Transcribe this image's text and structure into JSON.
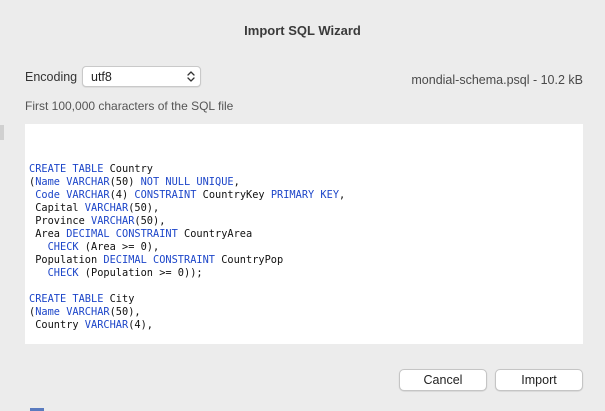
{
  "window": {
    "title": "Import SQL Wizard"
  },
  "encoding": {
    "label": "Encoding",
    "value": "utf8"
  },
  "file": {
    "info": "mondial-schema.psql - 10.2 kB"
  },
  "preview": {
    "label": "First 100,000 characters of the SQL file",
    "lines": [
      [],
      [],
      [],
      [
        [
          "kw",
          "CREATE TABLE "
        ],
        [
          "tx",
          "Country"
        ]
      ],
      [
        [
          "tx",
          "("
        ],
        [
          "kw",
          "Name VARCHAR"
        ],
        [
          "tx",
          "(50) "
        ],
        [
          "kw",
          "NOT NULL UNIQUE"
        ],
        [
          "tx",
          ","
        ]
      ],
      [
        [
          "tx",
          " "
        ],
        [
          "kw",
          "Code VARCHAR"
        ],
        [
          "tx",
          "(4) "
        ],
        [
          "kw",
          "CONSTRAINT"
        ],
        [
          "tx",
          " CountryKey "
        ],
        [
          "kw",
          "PRIMARY KEY"
        ],
        [
          "tx",
          ","
        ]
      ],
      [
        [
          "tx",
          " Capital "
        ],
        [
          "kw",
          "VARCHAR"
        ],
        [
          "tx",
          "(50),"
        ]
      ],
      [
        [
          "tx",
          " Province "
        ],
        [
          "kw",
          "VARCHAR"
        ],
        [
          "tx",
          "(50),"
        ]
      ],
      [
        [
          "tx",
          " Area "
        ],
        [
          "kw",
          "DECIMAL CONSTRAINT"
        ],
        [
          "tx",
          " CountryArea"
        ]
      ],
      [
        [
          "tx",
          "   "
        ],
        [
          "kw",
          "CHECK"
        ],
        [
          "tx",
          " (Area >= 0),"
        ]
      ],
      [
        [
          "tx",
          " Population "
        ],
        [
          "kw",
          "DECIMAL CONSTRAINT"
        ],
        [
          "tx",
          " CountryPop"
        ]
      ],
      [
        [
          "tx",
          "   "
        ],
        [
          "kw",
          "CHECK"
        ],
        [
          "tx",
          " (Population >= 0));"
        ]
      ],
      [],
      [
        [
          "kw",
          "CREATE TABLE "
        ],
        [
          "tx",
          "City"
        ]
      ],
      [
        [
          "tx",
          "("
        ],
        [
          "kw",
          "Name VARCHAR"
        ],
        [
          "tx",
          "(50),"
        ]
      ],
      [
        [
          "tx",
          " Country "
        ],
        [
          "kw",
          "VARCHAR"
        ],
        [
          "tx",
          "(4),"
        ]
      ]
    ]
  },
  "buttons": {
    "cancel": "Cancel",
    "import": "Import"
  },
  "colors": {
    "keyword": "#1d46c9",
    "background": "#ececec"
  }
}
